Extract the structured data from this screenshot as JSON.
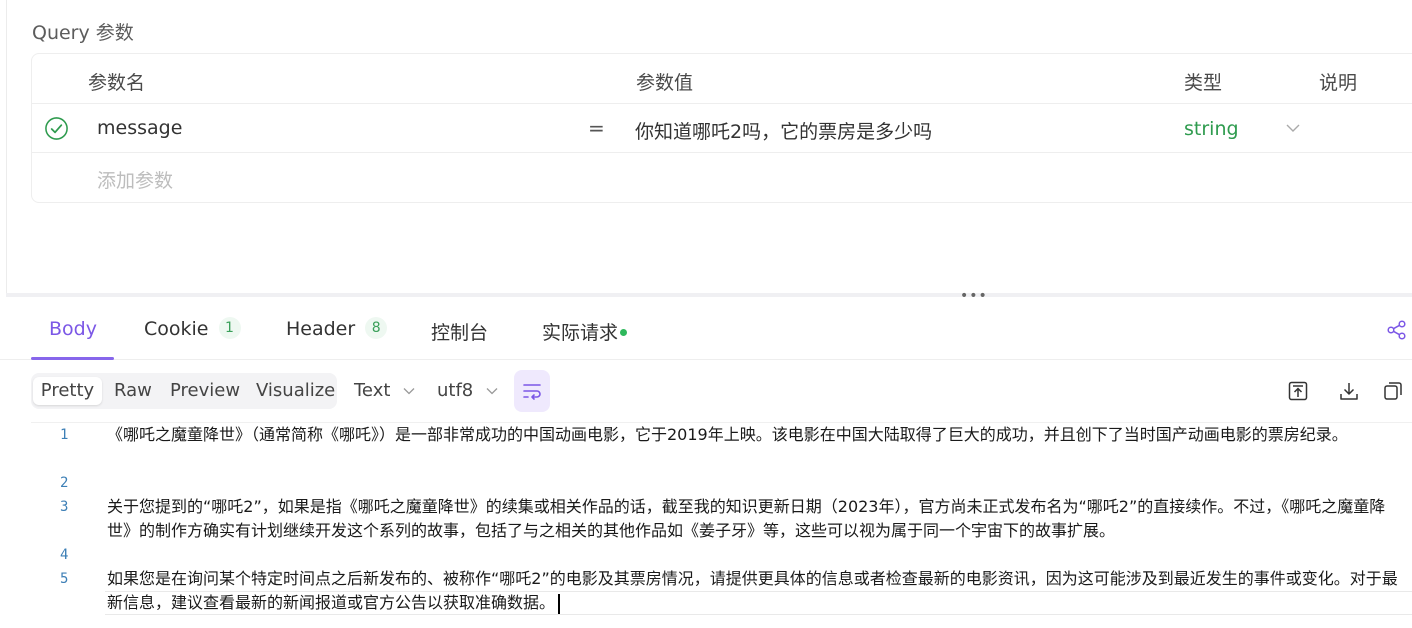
{
  "query": {
    "section_title": "Query 参数",
    "headers": {
      "name": "参数名",
      "value": "参数值",
      "type": "类型",
      "desc": "说明"
    },
    "row": {
      "name": "message",
      "eq": "=",
      "value": "你知道哪吒2吗，它的票房是多少吗",
      "type": "string"
    },
    "add_placeholder": "添加参数"
  },
  "response_tabs": [
    {
      "label": "Body",
      "badge": ""
    },
    {
      "label": "Cookie",
      "badge": "1"
    },
    {
      "label": "Header",
      "badge": "8"
    },
    {
      "label": "控制台",
      "badge": ""
    },
    {
      "label": "实际请求",
      "badge": ""
    }
  ],
  "toolbar": {
    "views": [
      "Pretty",
      "Raw",
      "Preview",
      "Visualize"
    ],
    "format": "Text",
    "encoding": "utf8"
  },
  "body_lines": [
    {
      "num": "1",
      "text": "《哪吒之魔童降世》（通常简称《哪吒》）是一部非常成功的中国动画电影，它于2019年上映。该电影在中国大陆取得了巨大的成功，并且创下了当时国产动画电影的票房纪录。"
    },
    {
      "num": "2",
      "text": ""
    },
    {
      "num": "3",
      "text": "关于您提到的“哪吒2”，如果是指《哪吒之魔童降世》的续集或相关作品的话，截至我的知识更新日期（2023年），官方尚未正式发布名为“哪吒2”的直接续作。不过，《哪吒之魔童降世》的制作方确实有计划继续开发这个系列的故事，包括了与之相关的其他作品如《姜子牙》等，这些可以视为属于同一个宇宙下的故事扩展。"
    },
    {
      "num": "4",
      "text": ""
    },
    {
      "num": "5",
      "text": "如果您是在询问某个特定时间点之后新发布的、被称作“哪吒2”的电影及其票房情况，请提供更具体的信息或者检查最新的电影资讯，因为这可能涉及到最近发生的事件或变化。对于最新信息，建议查看最新的新闻报道或官方公告以获取准确数据。"
    }
  ]
}
